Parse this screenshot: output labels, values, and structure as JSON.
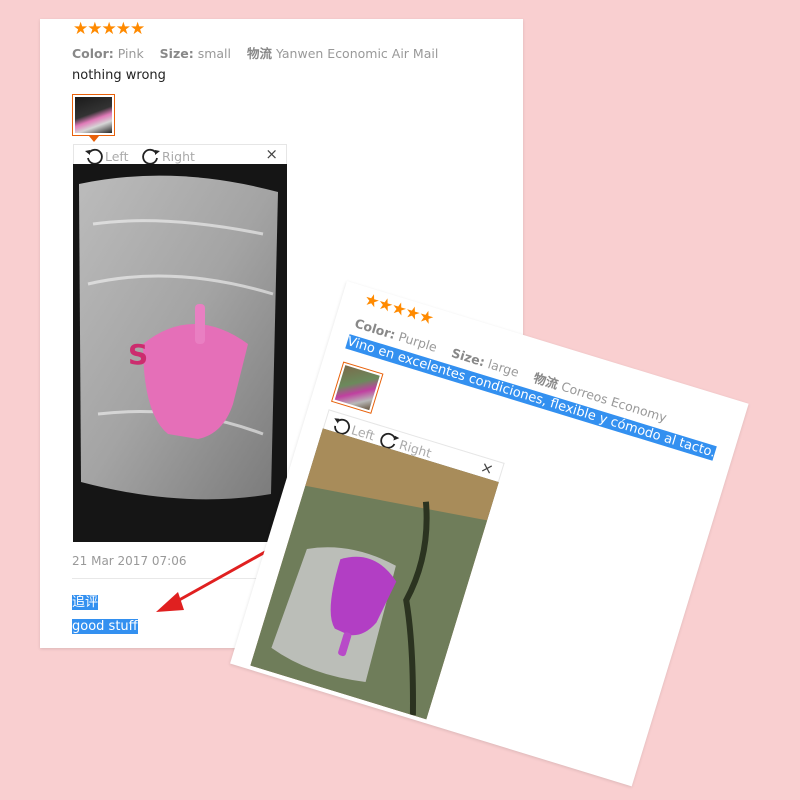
{
  "review1": {
    "stars": "★★★★★",
    "color_label": "Color:",
    "color_value": "Pink",
    "size_label": "Size:",
    "size_value": "small",
    "shipping_label": "物流",
    "shipping_value": "Yanwen Economic Air Mail",
    "text": "nothing wrong",
    "rotate_left": "Left",
    "rotate_right": "Right",
    "close": "×",
    "date": "21 Mar 2017 07:06",
    "additional_label": "追评",
    "additional_text": "good stuff"
  },
  "review2": {
    "stars": "★★★★★",
    "color_label": "Color:",
    "color_value": "Purple",
    "size_label": "Size:",
    "size_value": "large",
    "shipping_label": "物流",
    "shipping_value": "Correos Economy",
    "text": "Vino en excelentes condiciones, flexible y cómodo al tacto.",
    "rotate_left": "Left",
    "rotate_right": "Right",
    "close": "×"
  },
  "colors": {
    "background": "#f9cfd0",
    "star": "#ff8a00",
    "highlight": "#3390f0",
    "thumb_border": "#e8610a",
    "arrow": "#e02020"
  }
}
